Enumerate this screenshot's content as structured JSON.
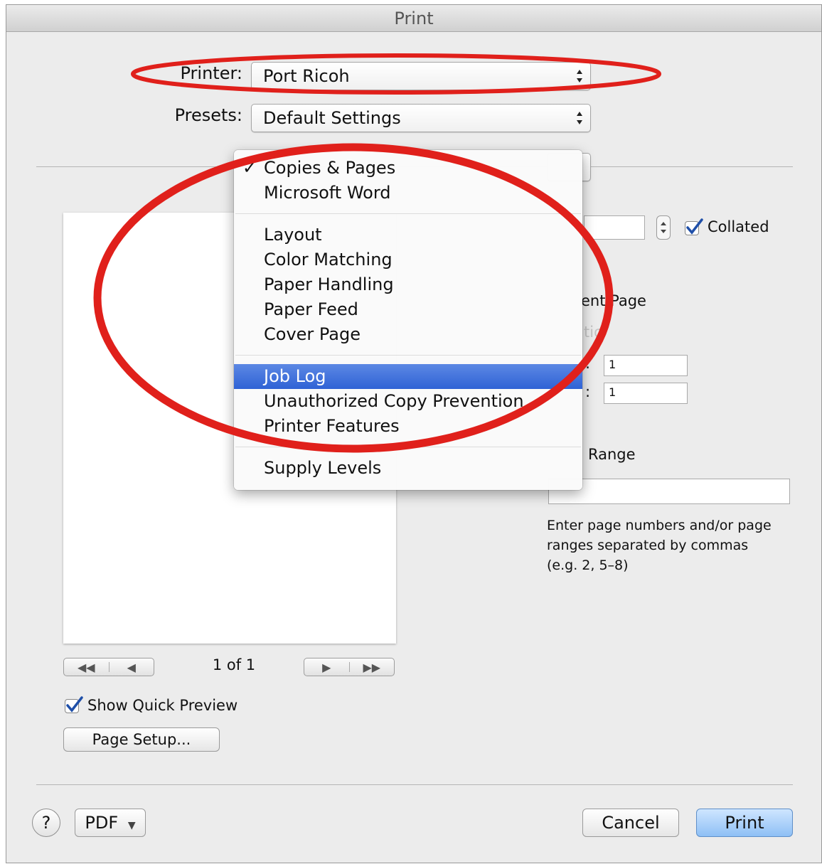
{
  "window": {
    "title": "Print"
  },
  "printer": {
    "label": "Printer:",
    "value": "Port Ricoh"
  },
  "presets": {
    "label": "Presets:",
    "value": "Default Settings"
  },
  "panel_menu": {
    "groups": [
      [
        {
          "label": "Copies & Pages",
          "checked": true
        },
        {
          "label": "Microsoft Word"
        }
      ],
      [
        {
          "label": "Layout"
        },
        {
          "label": "Color Matching"
        },
        {
          "label": "Paper Handling"
        },
        {
          "label": "Paper Feed"
        },
        {
          "label": "Cover Page"
        }
      ],
      [
        {
          "label": "Job Log",
          "highlighted": true
        },
        {
          "label": "Unauthorized Copy Prevention"
        },
        {
          "label": "Printer Features"
        }
      ],
      [
        {
          "label": "Supply Levels"
        }
      ]
    ],
    "check_glyph": "✓"
  },
  "copies": {
    "collated_label": "Collated",
    "collated_checked": true
  },
  "pages": {
    "current_page_label": "ent Page",
    "selection_label": "tio",
    "from_value": "1",
    "to_value": "1",
    "from_colon": ":",
    "to_colon": ":",
    "range_label": "Range",
    "range_value": "",
    "hint": "Enter page numbers and/or page ranges separated by commas (e.g. 2, 5–8)"
  },
  "preview": {
    "page_indicator": "1 of 1",
    "first_icon": "first-page-icon",
    "prev_icon": "previous-page-icon",
    "next_icon": "next-page-icon",
    "last_icon": "last-page-icon"
  },
  "show_quick_preview": {
    "label": "Show Quick Preview",
    "checked": true
  },
  "page_setup_button": "Page Setup...",
  "footer": {
    "help_label": "?",
    "pdf_label": "PDF",
    "cancel_label": "Cancel",
    "print_label": "Print"
  },
  "colors": {
    "annotation_red": "#e0201b",
    "menu_highlight": "#3b6fd9",
    "default_button": "#8ec0f5"
  }
}
